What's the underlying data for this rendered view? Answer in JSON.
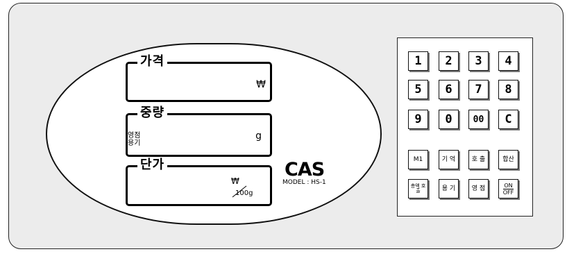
{
  "displays": {
    "price": {
      "label": "가격",
      "unit": "₩"
    },
    "weight": {
      "label": "중량",
      "unit": "g",
      "tare_line1": "영점",
      "tare_line2": "용기"
    },
    "unit_price": {
      "label": "단가",
      "unit": "₩",
      "per": "100g"
    }
  },
  "brand": {
    "logo": "CAS",
    "model": "MODEL : HS-1"
  },
  "keypad": {
    "keys": [
      "1",
      "2",
      "3",
      "4",
      "5",
      "6",
      "7",
      "8",
      "9",
      "0",
      "00",
      "C",
      "M1",
      "기 억",
      "호 출",
      "합산",
      "총액 호출",
      "용 기",
      "영 점"
    ],
    "onoff": {
      "on": "ON",
      "off": "OFF"
    }
  }
}
